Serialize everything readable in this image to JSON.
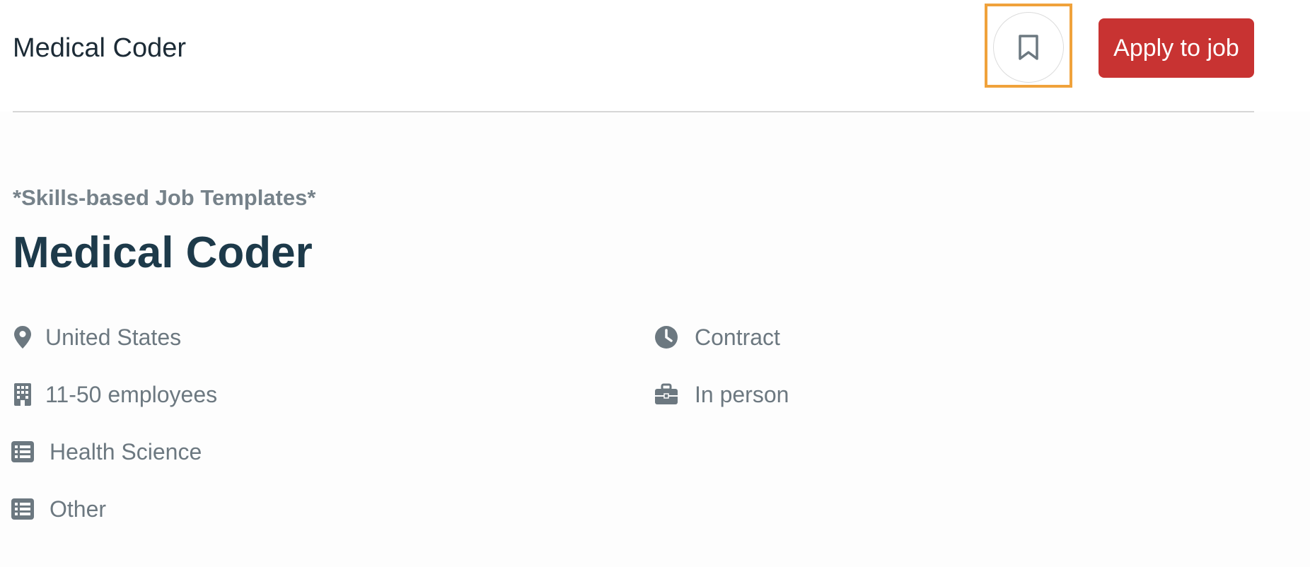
{
  "header": {
    "title": "Medical Coder",
    "save_icon": "bookmark-icon",
    "apply_label": "Apply to job"
  },
  "job": {
    "eyebrow": "*Skills-based Job Templates*",
    "title": "Medical Coder",
    "location": "United States",
    "company_size": "11-50 employees",
    "category_1": "Health Science",
    "category_2": "Other",
    "employment_type": "Contract",
    "workplace": "In person"
  },
  "icons": {
    "location": "map-pin-icon",
    "company_size": "building-icon",
    "category": "list-icon",
    "employment_type": "clock-icon",
    "workplace": "briefcase-icon"
  },
  "colors": {
    "accent": "#c83332",
    "highlight": "#f0a23b",
    "title": "#1d3a4a",
    "muted": "#6c7880"
  }
}
